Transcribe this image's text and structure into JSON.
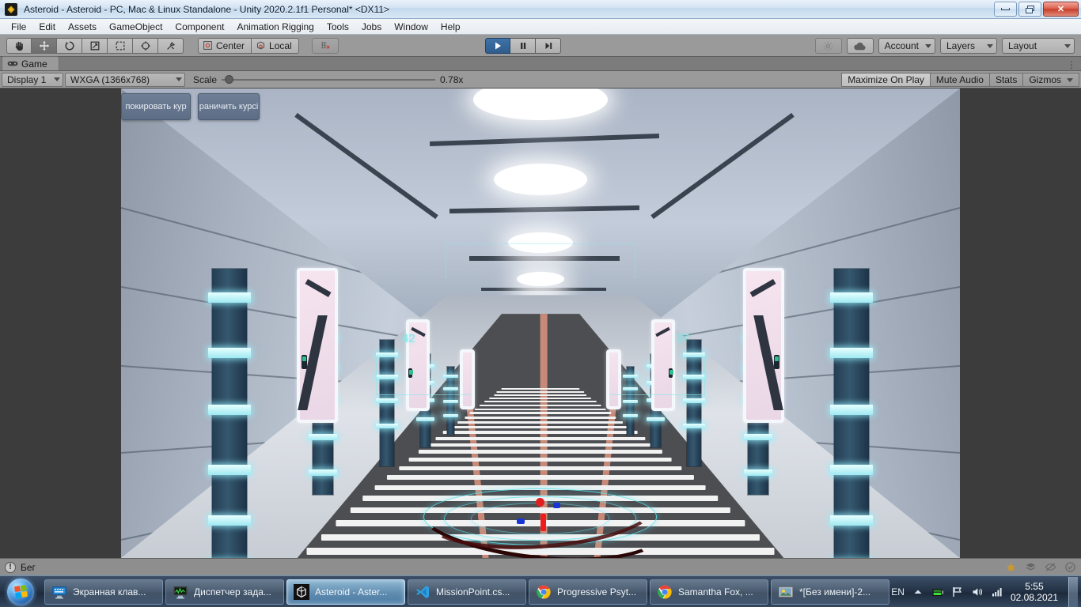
{
  "window": {
    "title": "Asteroid - Asteroid - PC, Mac & Linux Standalone - Unity 2020.2.1f1 Personal* <DX11>",
    "app_icon": "unity-icon",
    "minimize_label": "Minimize",
    "restore_label": "Restore",
    "close_label": "✕"
  },
  "menu": {
    "items": [
      {
        "label": "File"
      },
      {
        "label": "Edit"
      },
      {
        "label": "Assets"
      },
      {
        "label": "GameObject"
      },
      {
        "label": "Component"
      },
      {
        "label": "Animation Rigging"
      },
      {
        "label": "Tools"
      },
      {
        "label": "Jobs"
      },
      {
        "label": "Window"
      },
      {
        "label": "Help"
      }
    ]
  },
  "toolbar": {
    "tools": [
      {
        "name": "hand-tool",
        "active": false
      },
      {
        "name": "move-tool",
        "active": true
      },
      {
        "name": "rotate-tool",
        "active": false
      },
      {
        "name": "scale-tool",
        "active": false
      },
      {
        "name": "rect-tool",
        "active": false
      },
      {
        "name": "transform-tool",
        "active": false
      },
      {
        "name": "custom-tool",
        "active": false
      }
    ],
    "pivot_label": "Center",
    "handle_label": "Local",
    "grid_snap_label": "Grid Snapping",
    "play_label": "▶",
    "pause_label": "‖",
    "step_label": "▶|",
    "collab_label": "Collab",
    "cloud_label": "Cloud",
    "account_label": "Account",
    "layers_label": "Layers",
    "layout_label": "Layout"
  },
  "gameview": {
    "tab_label": "Game",
    "tab_icon": "gamepad-icon",
    "display_label": "Display 1",
    "resolution_label": "WXGA (1366x768)",
    "scale_label": "Scale",
    "scale_value": "0.78x",
    "maximize_label": "Maximize On Play",
    "mute_label": "Mute Audio",
    "stats_label": "Stats",
    "gizmos_label": "Gizmos"
  },
  "game_hud": {
    "buttons": [
      {
        "label": "покировать кур"
      },
      {
        "label": "раничить курсі"
      }
    ],
    "door_numbers": [
      {
        "value": "42"
      },
      {
        "value": "37"
      }
    ]
  },
  "status_bar": {
    "message": "Бег",
    "icons": [
      "bug-icon",
      "layers-icon",
      "eye-off-icon",
      "check-circle-icon"
    ]
  },
  "taskbar": {
    "start_label": "Start",
    "items": [
      {
        "label": "Экранная клав...",
        "icon": "onscreen-keyboard-icon",
        "active": false
      },
      {
        "label": "Диспетчер зада...",
        "icon": "task-manager-icon",
        "active": false
      },
      {
        "label": "Asteroid - Aster...",
        "icon": "unity-icon",
        "active": true
      },
      {
        "label": "MissionPoint.cs...",
        "icon": "vscode-icon",
        "active": false
      },
      {
        "label": "Progressive Psyt...",
        "icon": "chrome-icon",
        "active": false
      },
      {
        "label": "Samantha Fox, ...",
        "icon": "chrome-icon",
        "active": false
      },
      {
        "label": "*[Без имени]-2...",
        "icon": "paint-icon",
        "active": false
      }
    ],
    "tray": {
      "language": "EN",
      "icons": [
        "show-hidden-icon",
        "battery-icon",
        "flag-icon",
        "volume-icon",
        "network-icon"
      ],
      "time": "5:55",
      "date": "02.08.2021"
    }
  },
  "colors": {
    "accent_blue": "#3f72a8",
    "hud_cyan": "#86e6e8",
    "pillar_blue": "#35586f",
    "close_red": "#c63f2c"
  }
}
